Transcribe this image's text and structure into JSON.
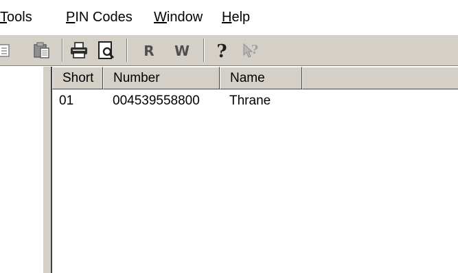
{
  "menu": {
    "tools": {
      "mnemonic": "T",
      "rest": "ools"
    },
    "pin_codes": {
      "mnemonic": "P",
      "rest": "IN Codes"
    },
    "window": {
      "mnemonic": "W",
      "rest": "indow"
    },
    "help": {
      "mnemonic": "H",
      "rest": "elp"
    }
  },
  "toolbar": {
    "icons": [
      "copy-icon",
      "paste-icon",
      "print-icon",
      "print-preview-icon",
      "read-icon",
      "write-icon",
      "help-icon",
      "context-help-icon"
    ],
    "read_glyph": "R",
    "write_glyph": "W",
    "help_glyph": "?"
  },
  "list": {
    "columns": [
      "Short",
      "Number",
      "Name"
    ],
    "rows": [
      {
        "short": "01",
        "number": "004539558800",
        "name": "Thrane"
      }
    ]
  }
}
